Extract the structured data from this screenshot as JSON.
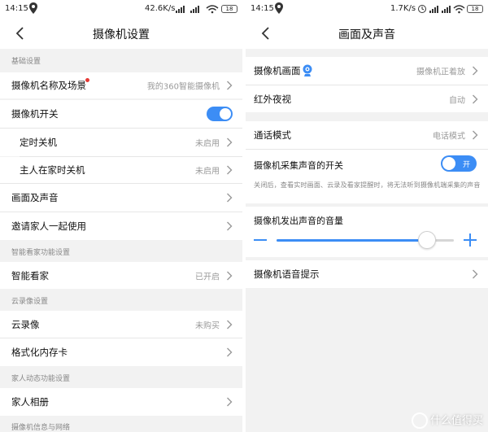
{
  "left": {
    "status": {
      "time": "14:15",
      "speed": "42.6K/s",
      "battery": "18"
    },
    "nav": {
      "title": "摄像机设置"
    },
    "sections": {
      "basic": "基础设置",
      "smart": "智能看家功能设置",
      "cloud": "云录像设置",
      "family": "家人动态功能设置",
      "cut": "摄像机信息与网络"
    },
    "rows": {
      "name": {
        "label": "摄像机名称及场景",
        "value": "我的360智能摄像机"
      },
      "power": {
        "label": "摄像机开关"
      },
      "timer_off": {
        "label": "定时关机",
        "value": "未启用"
      },
      "home_off": {
        "label": "主人在家时关机",
        "value": "未启用"
      },
      "screen_sound": {
        "label": "画面及声音"
      },
      "invite": {
        "label": "邀请家人一起使用"
      },
      "smart_guard": {
        "label": "智能看家",
        "value": "已开启"
      },
      "cloud_rec": {
        "label": "云录像",
        "value": "未购买"
      },
      "format": {
        "label": "格式化内存卡"
      },
      "album": {
        "label": "家人相册"
      }
    }
  },
  "right": {
    "status": {
      "time": "14:15",
      "speed": "1.7K/s",
      "battery": "18"
    },
    "nav": {
      "title": "画面及声音"
    },
    "rows": {
      "picture": {
        "label": "摄像机画面",
        "value": "摄像机正着放"
      },
      "ir": {
        "label": "红外夜视",
        "value": "自动"
      },
      "call": {
        "label": "通话模式",
        "value": "电话模式"
      },
      "capture_sound": {
        "label": "摄像机采集声音的开关",
        "toggle_text": "开"
      },
      "note": "关闭后，查看实时画面、云录及看家提醒时，将无法听到摄像机端采集的声音",
      "volume": {
        "label": "摄像机发出声音的音量",
        "level": 0.85
      },
      "voice_prompt": {
        "label": "摄像机语音提示"
      }
    }
  },
  "watermark": "什么值得买",
  "colors": {
    "accent": "#3c8df5",
    "bg": "#f2f2f2",
    "dot": "#e53935"
  }
}
